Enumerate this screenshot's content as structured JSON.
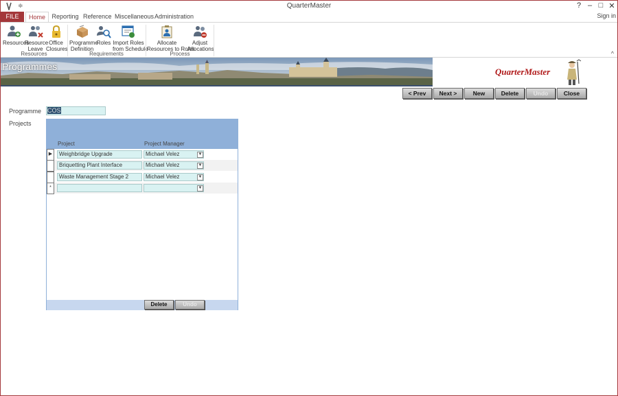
{
  "window": {
    "title": "QuarterMaster",
    "qat_glyph": "≑",
    "help": "?",
    "minimize": "–",
    "maximize": "□",
    "close": "✕",
    "sign_in": "Sign in"
  },
  "tabs": [
    {
      "label": "FILE"
    },
    {
      "label": "Home"
    },
    {
      "label": "Reporting"
    },
    {
      "label": "Reference"
    },
    {
      "label": "Miscellaneous"
    },
    {
      "label": "Administration"
    }
  ],
  "ribbon": {
    "groups": [
      {
        "label": "Resources"
      },
      {
        "label": "Requirements"
      },
      {
        "label": "Process"
      }
    ],
    "buttons": [
      {
        "line1": "Resources",
        "line2": "",
        "icon": "people-add-icon"
      },
      {
        "line1": "Resource",
        "line2": "Leave",
        "icon": "people-leave-icon"
      },
      {
        "line1": "Office",
        "line2": "Closures",
        "icon": "lock-icon"
      },
      {
        "line1": "Programme",
        "line2": "Definition",
        "icon": "box-icon"
      },
      {
        "line1": "Roles",
        "line2": "",
        "icon": "people-search-icon"
      },
      {
        "line1": "Import Roles",
        "line2": "from Schedule",
        "icon": "schedule-import-icon"
      },
      {
        "line1": "Allocate",
        "line2": "Resources to Roles",
        "icon": "clipboard-people-icon"
      },
      {
        "line1": "Adjust",
        "line2": "Allocations",
        "icon": "people-adjust-icon"
      }
    ],
    "collapse_glyph": "^"
  },
  "banner": {
    "title": "Programmes",
    "brand": "QuarterMaster"
  },
  "nav": {
    "prev": "< Prev",
    "next": "Next >",
    "new": "New",
    "delete": "Delete",
    "undo": "Undo",
    "close": "Close"
  },
  "form": {
    "programme_label": "Programme",
    "programme_value": "COS",
    "projects_label": "Projects"
  },
  "subform": {
    "columns": {
      "project": "Project",
      "manager": "Project Manager"
    },
    "rows": [
      {
        "project": "Weighbridge Upgrade",
        "manager": "Michael Velez",
        "selector": "▶"
      },
      {
        "project": "Briquetting Plant Interface",
        "manager": "Michael Velez",
        "selector": ""
      },
      {
        "project": "Waste Management Stage 2",
        "manager": "Michael Velez",
        "selector": ""
      },
      {
        "project": "",
        "manager": "",
        "selector": "*"
      }
    ],
    "delete": "Delete",
    "undo": "Undo"
  },
  "colors": {
    "accent": "#a4373a",
    "subform_header": "#8fb0d9",
    "field_bg": "#d9f2f2"
  }
}
